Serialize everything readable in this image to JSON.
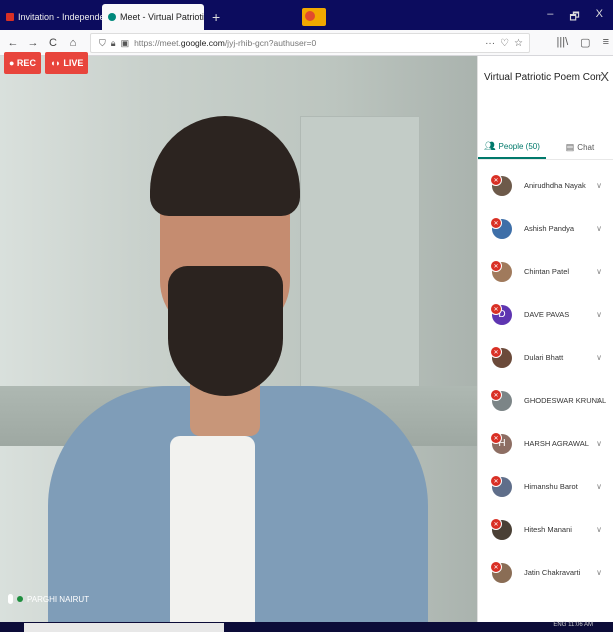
{
  "browser": {
    "tabs": [
      {
        "title": "Invitation - Independence Day",
        "close": "X",
        "active": false,
        "favicon_color": "#d93025"
      },
      {
        "title": "Meet - Virtual Patriotic Poe",
        "close": "X",
        "active": true,
        "favicon_color": "#00897b"
      }
    ],
    "new_tab": "+",
    "window_controls": [
      "–",
      "🗗",
      "X"
    ],
    "nav": {
      "back": "←",
      "forward": "→",
      "reload": "C",
      "home": "⌂"
    },
    "url": {
      "prefix": "https://meet.",
      "host": "google.com",
      "path": "/jyj-rhib-gcn?authuser=0"
    },
    "url_right_icons": [
      "···",
      "♡",
      "☆"
    ],
    "toolbar_right_icons": [
      "|||\\",
      "▢",
      "≡"
    ]
  },
  "meeting": {
    "badges": {
      "rec": "● REC",
      "live": "◖◗ LIVE"
    },
    "speaker_name": "PARGHI NAIRUT"
  },
  "panel": {
    "title": "Virtual Patriotic Poem Comp...",
    "close": "X",
    "tabs": {
      "people": "People (50)",
      "chat": "Chat"
    },
    "participants": [
      {
        "name": "Anirudhdha Nayak",
        "avatar": "",
        "color": "#6d5a4a"
      },
      {
        "name": "Ashish Pandya",
        "avatar": "",
        "color": "#3e6fa8"
      },
      {
        "name": "Chintan Patel",
        "avatar": "",
        "color": "#a07a5c"
      },
      {
        "name": "DAVE PAVAS",
        "avatar": "D",
        "color": "#5e35b1"
      },
      {
        "name": "Dulari Bhatt",
        "avatar": "",
        "color": "#6b4a3a"
      },
      {
        "name": "GHODESWAR KRUNAL",
        "avatar": "",
        "color": "#7c8587"
      },
      {
        "name": "HARSH AGRAWAL",
        "avatar": "H",
        "color": "#8d6e63"
      },
      {
        "name": "Himanshu Barot",
        "avatar": "",
        "color": "#5f6e8a"
      },
      {
        "name": "Hitesh Manani",
        "avatar": "",
        "color": "#4a4035"
      },
      {
        "name": "Jatin Chakravarti",
        "avatar": "",
        "color": "#8a6d55"
      }
    ]
  },
  "taskbar": {
    "clock": "ENG  11:06 AM"
  }
}
